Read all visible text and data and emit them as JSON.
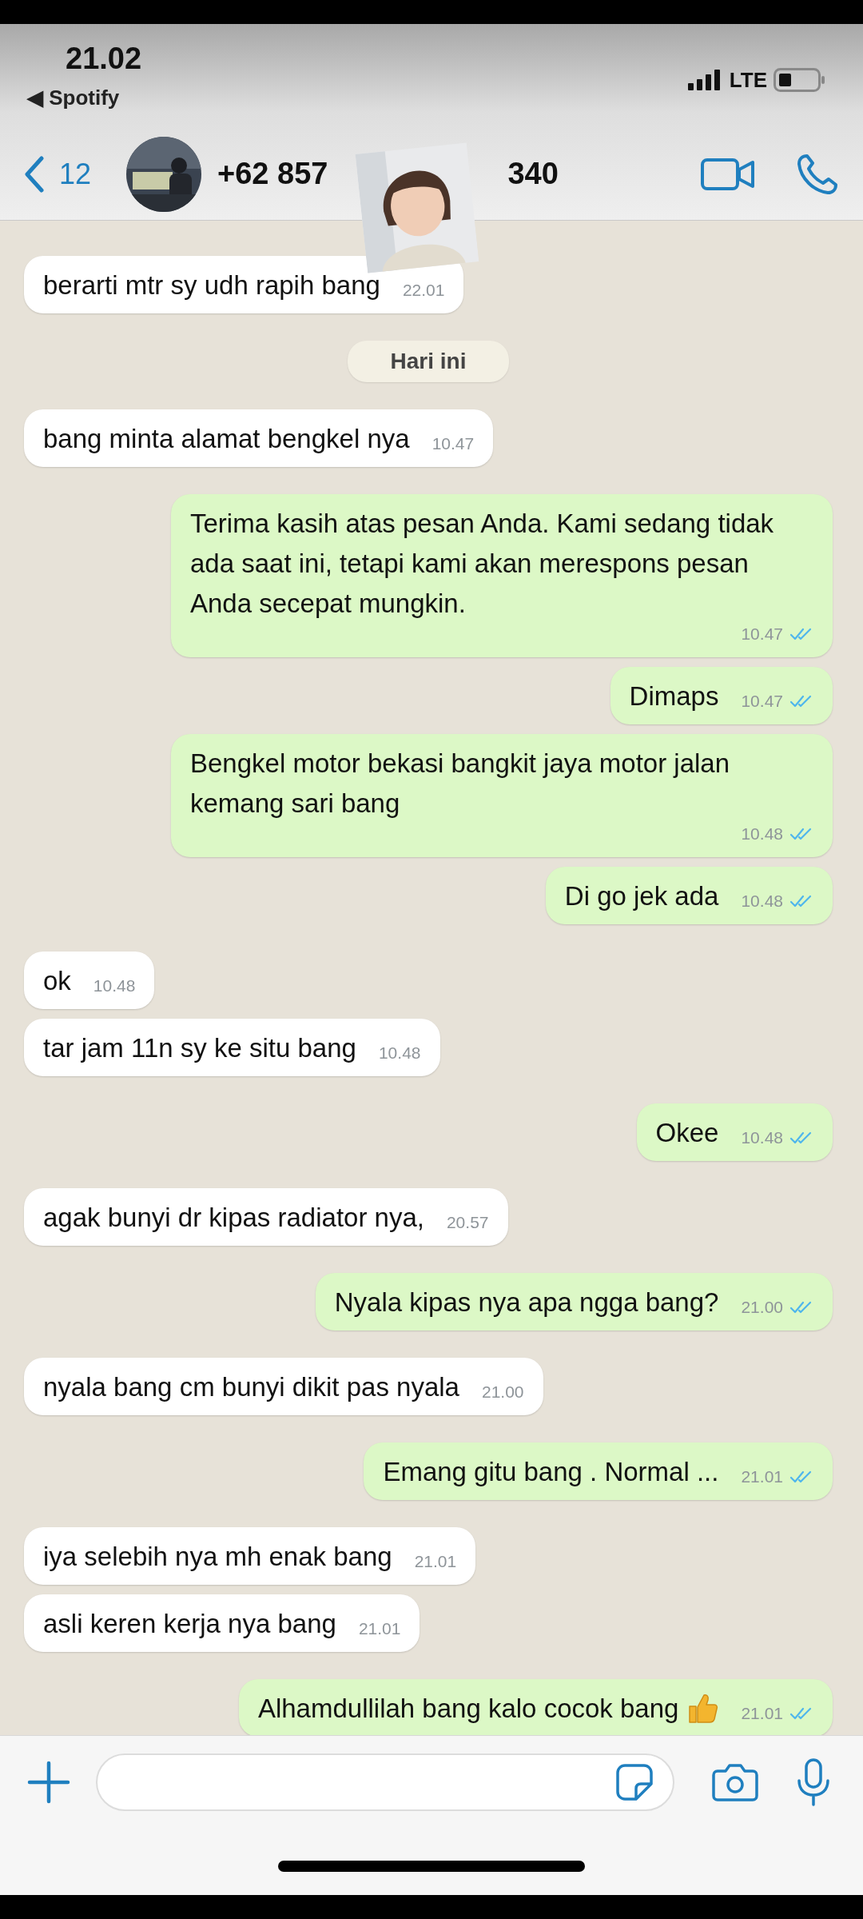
{
  "status_bar": {
    "time": "21.02",
    "back_app": "◀ Spotify",
    "network": "LTE"
  },
  "header": {
    "back_count": "12",
    "contact_name_parts": [
      "+62 857",
      "340"
    ]
  },
  "messages": [
    {
      "kind": "incoming",
      "text": "berarti mtr sy udh rapih bang",
      "time": "22.01"
    },
    {
      "kind": "date",
      "text": "Hari ini"
    },
    {
      "kind": "incoming",
      "text": "bang minta alamat bengkel nya",
      "time": "10.47"
    },
    {
      "kind": "outgoing",
      "text": "Terima kasih atas pesan Anda. Kami sedang tidak ada saat ini, tetapi kami akan merespons pesan Anda secepat mungkin.",
      "time": "10.47",
      "read": true
    },
    {
      "kind": "outgoing",
      "text": "Dimaps",
      "time": "10.47",
      "read": true
    },
    {
      "kind": "outgoing",
      "text": "Bengkel motor bekasi bangkit jaya motor jalan kemang sari bang",
      "time": "10.48",
      "read": true
    },
    {
      "kind": "outgoing",
      "text": "Di go jek ada",
      "time": "10.48",
      "read": true
    },
    {
      "kind": "incoming",
      "text": "ok",
      "time": "10.48"
    },
    {
      "kind": "incoming",
      "text": "tar jam 11n sy ke situ bang",
      "time": "10.48"
    },
    {
      "kind": "outgoing",
      "text": "Okee",
      "time": "10.48",
      "read": true
    },
    {
      "kind": "incoming",
      "text": "agak bunyi dr kipas radiator nya,",
      "time": "20.57"
    },
    {
      "kind": "outgoing",
      "text": "Nyala kipas nya apa ngga bang?",
      "time": "21.00",
      "read": true
    },
    {
      "kind": "incoming",
      "text": "nyala bang cm bunyi dikit pas nyala",
      "time": "21.00"
    },
    {
      "kind": "outgoing",
      "text": "Emang gitu bang . Normal ...",
      "time": "21.01",
      "read": true
    },
    {
      "kind": "incoming",
      "text": "iya selebih nya mh enak bang",
      "time": "21.01"
    },
    {
      "kind": "incoming",
      "text": "asli keren kerja nya bang",
      "time": "21.01"
    },
    {
      "kind": "outgoing",
      "text": "Alhamdullilah bang kalo cocok bang",
      "time": "21.01",
      "read": true,
      "thumbs_up": true
    }
  ]
}
